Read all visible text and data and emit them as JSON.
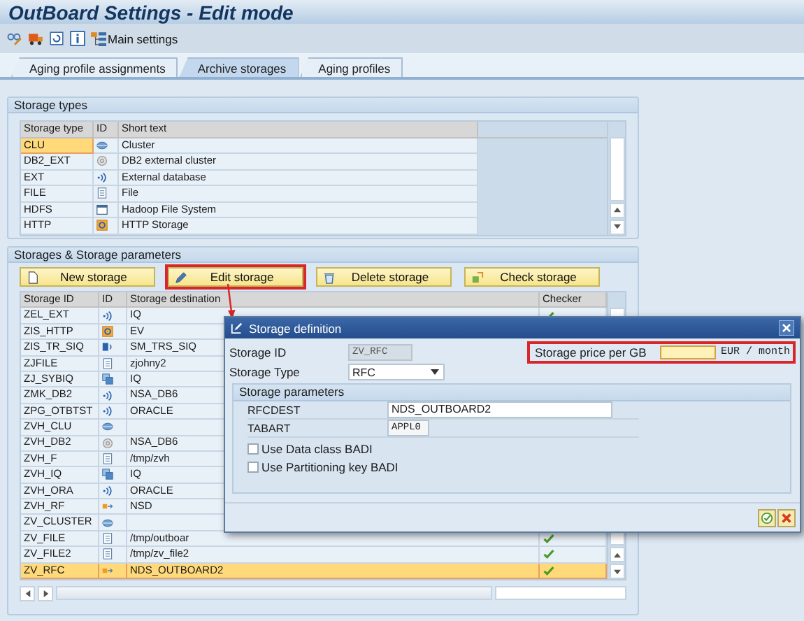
{
  "window": {
    "title": "OutBoard Settings - Edit mode"
  },
  "toolbar": {
    "buttons": [
      {
        "label": "Main settings"
      }
    ]
  },
  "tabs": [
    {
      "label": "Aging profile assignments",
      "selected": false
    },
    {
      "label": "Archive storages",
      "selected": true
    },
    {
      "label": "Aging profiles",
      "selected": false
    }
  ],
  "storage_types": {
    "title": "Storage types",
    "columns": [
      "Storage type",
      "ID",
      "Short text"
    ],
    "rows": [
      {
        "storage_type": "CLU",
        "kind": "cluster",
        "short_text": "Cluster",
        "selected": true
      },
      {
        "storage_type": "DB2_EXT",
        "kind": "db2",
        "short_text": "DB2 external cluster",
        "selected": false
      },
      {
        "storage_type": "EXT",
        "kind": "external",
        "short_text": "External database",
        "selected": false
      },
      {
        "storage_type": "FILE",
        "kind": "file",
        "short_text": "File",
        "selected": false
      },
      {
        "storage_type": "HDFS",
        "kind": "hdfs",
        "short_text": "Hadoop File System",
        "selected": false
      },
      {
        "storage_type": "HTTP",
        "kind": "http",
        "short_text": "HTTP Storage",
        "selected": false
      }
    ]
  },
  "storages": {
    "title": "Storages & Storage parameters",
    "buttons": [
      {
        "label": "New storage",
        "kind": "new",
        "highlighted": false
      },
      {
        "label": "Edit storage",
        "kind": "edit",
        "highlighted": true
      },
      {
        "label": "Delete storage",
        "kind": "delete",
        "highlighted": false
      },
      {
        "label": "Check storage",
        "kind": "check",
        "highlighted": false
      }
    ],
    "columns": [
      "Storage ID",
      "ID",
      "Storage destination",
      "Checker"
    ],
    "rows": [
      {
        "storage_id": "ZEL_EXT",
        "kind": "external",
        "destination": "IQ",
        "selected": false,
        "checked": true
      },
      {
        "storage_id": "ZIS_HTTP",
        "kind": "http",
        "destination": "EV",
        "selected": false
      },
      {
        "storage_id": "ZIS_TR_SIQ",
        "kind": "transfer",
        "destination": "SM_TRS_SIQ",
        "selected": false
      },
      {
        "storage_id": "ZJFILE",
        "kind": "file",
        "destination": "zjohny2",
        "selected": false
      },
      {
        "storage_id": "ZJ_SYBIQ",
        "kind": "iq",
        "destination": "IQ",
        "selected": false
      },
      {
        "storage_id": "ZMK_DB2",
        "kind": "external",
        "destination": "NSA_DB6",
        "selected": false
      },
      {
        "storage_id": "ZPG_OTBTST",
        "kind": "external",
        "destination": "ORACLE",
        "selected": false
      },
      {
        "storage_id": "ZVH_CLU",
        "kind": "cluster",
        "selected": false
      },
      {
        "storage_id": "ZVH_DB2",
        "kind": "db2",
        "destination": "NSA_DB6",
        "selected": false
      },
      {
        "storage_id": "ZVH_F",
        "kind": "file",
        "destination": "/tmp/zvh",
        "selected": false
      },
      {
        "storage_id": "ZVH_IQ",
        "kind": "iq",
        "destination": "IQ",
        "selected": false
      },
      {
        "storage_id": "ZVH_ORA",
        "kind": "external",
        "destination": "ORACLE",
        "selected": false
      },
      {
        "storage_id": "ZVH_RF",
        "kind": "rfc",
        "destination": "NSD",
        "selected": false
      },
      {
        "storage_id": "ZV_CLUSTER",
        "kind": "cluster",
        "selected": false
      },
      {
        "storage_id": "ZV_FILE",
        "kind": "file",
        "destination": "/tmp/outboar",
        "selected": false,
        "checked": true
      },
      {
        "storage_id": "ZV_FILE2",
        "kind": "file",
        "destination": "/tmp/zv_file2",
        "selected": false,
        "checked": true
      },
      {
        "storage_id": "ZV_RFC",
        "kind": "rfc",
        "destination": "NDS_OUTBOARD2",
        "selected": true,
        "checked": true
      }
    ]
  },
  "dialog": {
    "title": "Storage definition",
    "storage_id": {
      "label": "Storage ID",
      "value": "ZV_RFC"
    },
    "storage_type": {
      "label": "Storage Type",
      "value": "RFC"
    },
    "price": {
      "label": "Storage price per GB",
      "unit": "EUR / month",
      "highlighted": true
    },
    "parameters": {
      "title": "Storage parameters",
      "fields": [
        {
          "label": "RFCDEST",
          "value": "NDS_OUTBOARD2",
          "kind": "wide"
        },
        {
          "label": "TABART",
          "value": "APPL0",
          "kind": "short"
        }
      ],
      "checkboxes": [
        {
          "label": "Use Data class BADI",
          "checked": false
        },
        {
          "label": "Use Partitioning key BADI",
          "checked": false
        }
      ]
    }
  }
}
